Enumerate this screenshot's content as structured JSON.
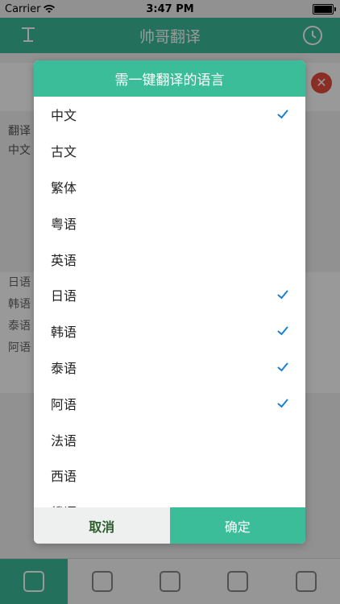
{
  "status_bar": {
    "carrier": "Carrier",
    "time": "3:47 PM"
  },
  "app": {
    "title": "帅哥翻译"
  },
  "background": {
    "text_a": "翻译",
    "text_b": "中文",
    "rows": [
      "日语",
      "韩语",
      "泰语",
      "阿语"
    ]
  },
  "dialog": {
    "title": "需一键翻译的语言",
    "languages": [
      {
        "label": "中文",
        "checked": true
      },
      {
        "label": "古文",
        "checked": false
      },
      {
        "label": "繁体",
        "checked": false
      },
      {
        "label": "粤语",
        "checked": false
      },
      {
        "label": "英语",
        "checked": false
      },
      {
        "label": "日语",
        "checked": true
      },
      {
        "label": "韩语",
        "checked": true
      },
      {
        "label": "泰语",
        "checked": true
      },
      {
        "label": "阿语",
        "checked": true
      },
      {
        "label": "法语",
        "checked": false
      },
      {
        "label": "西语",
        "checked": false
      },
      {
        "label": "俄语",
        "checked": false
      }
    ],
    "cancel_label": "取消",
    "confirm_label": "确定"
  },
  "colors": {
    "accent": "#3bbd99",
    "check": "#1a7fd6",
    "close": "#e74c3c"
  },
  "icons": {
    "check": "checkmark-icon",
    "wifi": "wifi-icon",
    "battery": "battery-icon"
  }
}
